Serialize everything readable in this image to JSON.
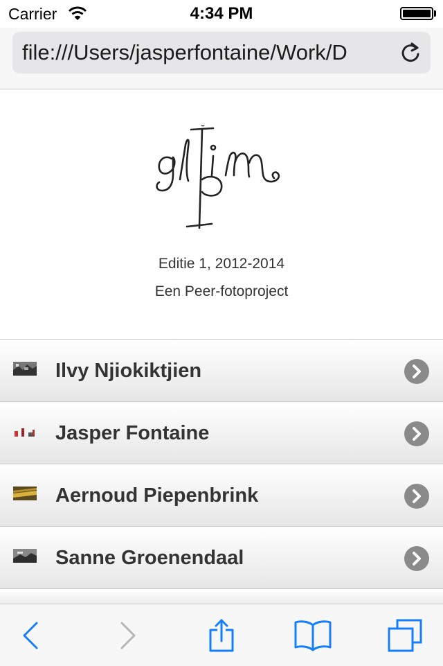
{
  "status": {
    "carrier": "Carrier",
    "time": "4:34 PM"
  },
  "browser": {
    "url": "file:///Users/jasperfontaine/Work/D"
  },
  "hero": {
    "logo_text": "glim",
    "edition": "Editie 1, 2012-2014",
    "subtitle": "Een Peer-fotoproject"
  },
  "list": {
    "items": [
      {
        "label": "Ilvy Njiokiktjien",
        "thumb": "photo-thumbnail"
      },
      {
        "label": "Jasper Fontaine",
        "thumb": "photo-thumbnail"
      },
      {
        "label": "Aernoud Piepenbrink",
        "thumb": "photo-thumbnail"
      },
      {
        "label": "Sanne Groenendaal",
        "thumb": "photo-thumbnail"
      }
    ]
  },
  "colors": {
    "accent": "#147efb",
    "disabled": "#b5b5b5",
    "chevron": "#8a8a8a"
  },
  "icons": {
    "toolbar": [
      "back-icon",
      "forward-icon",
      "share-icon",
      "bookmarks-icon",
      "tabs-icon"
    ],
    "reload": "reload-icon",
    "disclosure": "chevron-right-icon"
  }
}
